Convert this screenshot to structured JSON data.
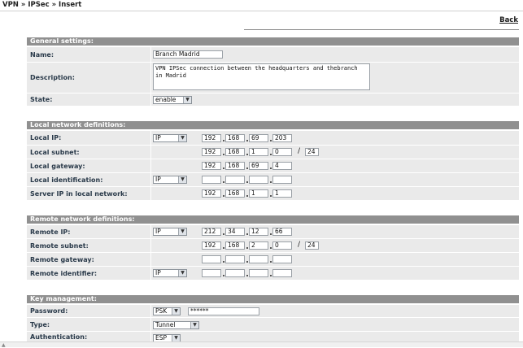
{
  "breadcrumb": "VPN » IPSec » Insert",
  "back_label": "Back",
  "general": {
    "header": "General settings:",
    "name_label": "Name:",
    "name_value": "Branch Madrid",
    "description_label": "Description:",
    "description_value": "VPN IPSec connection between the headquarters and thebranch in Madrid",
    "state_label": "State:",
    "state_value": "enable"
  },
  "local": {
    "header": "Local network definitions:",
    "local_ip_label": "Local IP:",
    "local_ip_type": "IP",
    "local_ip": [
      "192",
      "168",
      "69",
      "203"
    ],
    "local_subnet_label": "Local subnet:",
    "local_subnet": [
      "192",
      "168",
      "1",
      "0"
    ],
    "local_subnet_mask": "24",
    "local_gateway_label": "Local gateway:",
    "local_gateway": [
      "192",
      "168",
      "69",
      "4"
    ],
    "local_identification_label": "Local identification:",
    "local_identification_type": "IP",
    "local_identification": [
      "",
      "",
      "",
      ""
    ],
    "server_ip_label": "Server IP in local network:",
    "server_ip": [
      "192",
      "168",
      "1",
      "1"
    ]
  },
  "remote": {
    "header": "Remote network definitions:",
    "remote_ip_label": "Remote IP:",
    "remote_ip_type": "IP",
    "remote_ip": [
      "212",
      "34",
      "12",
      "66"
    ],
    "remote_subnet_label": "Remote subnet:",
    "remote_subnet": [
      "192",
      "168",
      "2",
      "0"
    ],
    "remote_subnet_mask": "24",
    "remote_gateway_label": "Remote gateway:",
    "remote_gateway": [
      "",
      "",
      "",
      ""
    ],
    "remote_identifier_label": "Remote identifier:",
    "remote_identifier_type": "IP",
    "remote_identifier": [
      "",
      "",
      "",
      ""
    ]
  },
  "keys": {
    "header": "Key management:",
    "password_label": "Password:",
    "password_type": "PSK",
    "password_value": "******",
    "type_label": "Type:",
    "type_value": "Tunnel",
    "authentication_label": "Authentication:",
    "authentication_value": "ESP"
  }
}
